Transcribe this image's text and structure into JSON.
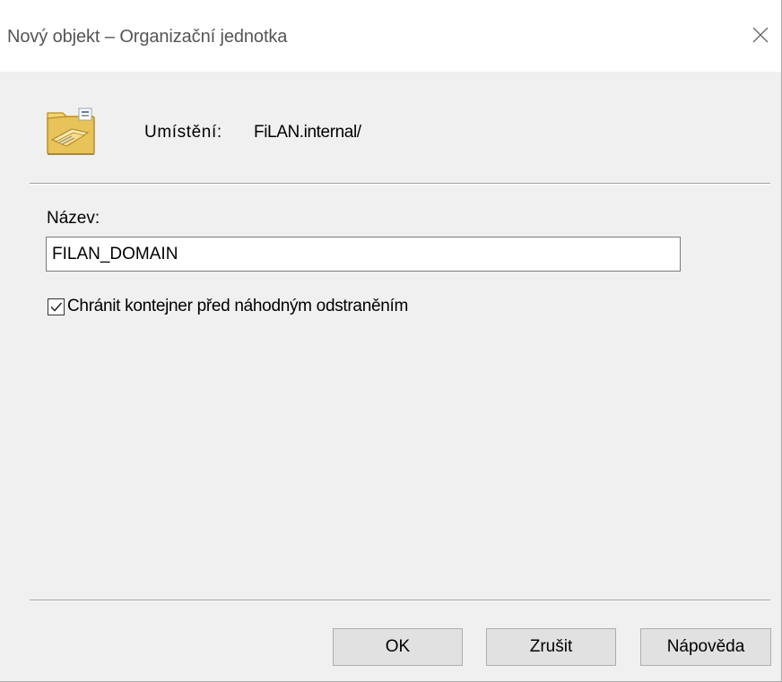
{
  "window": {
    "title": "Nový objekt – Organizační jednotka",
    "close_icon": "close-icon"
  },
  "location": {
    "icon": "folder-icon",
    "label": "Umístění:",
    "value": "FiLAN.internal/"
  },
  "form": {
    "name_label": "Název:",
    "name_value": "FILAN_DOMAIN",
    "protect_checkbox": {
      "label": "Chránit kontejner před náhodným odstraněním",
      "checked": true
    }
  },
  "buttons": {
    "ok_label": "OK",
    "cancel_label": "Zrušit",
    "help_label": "Nápověda"
  }
}
